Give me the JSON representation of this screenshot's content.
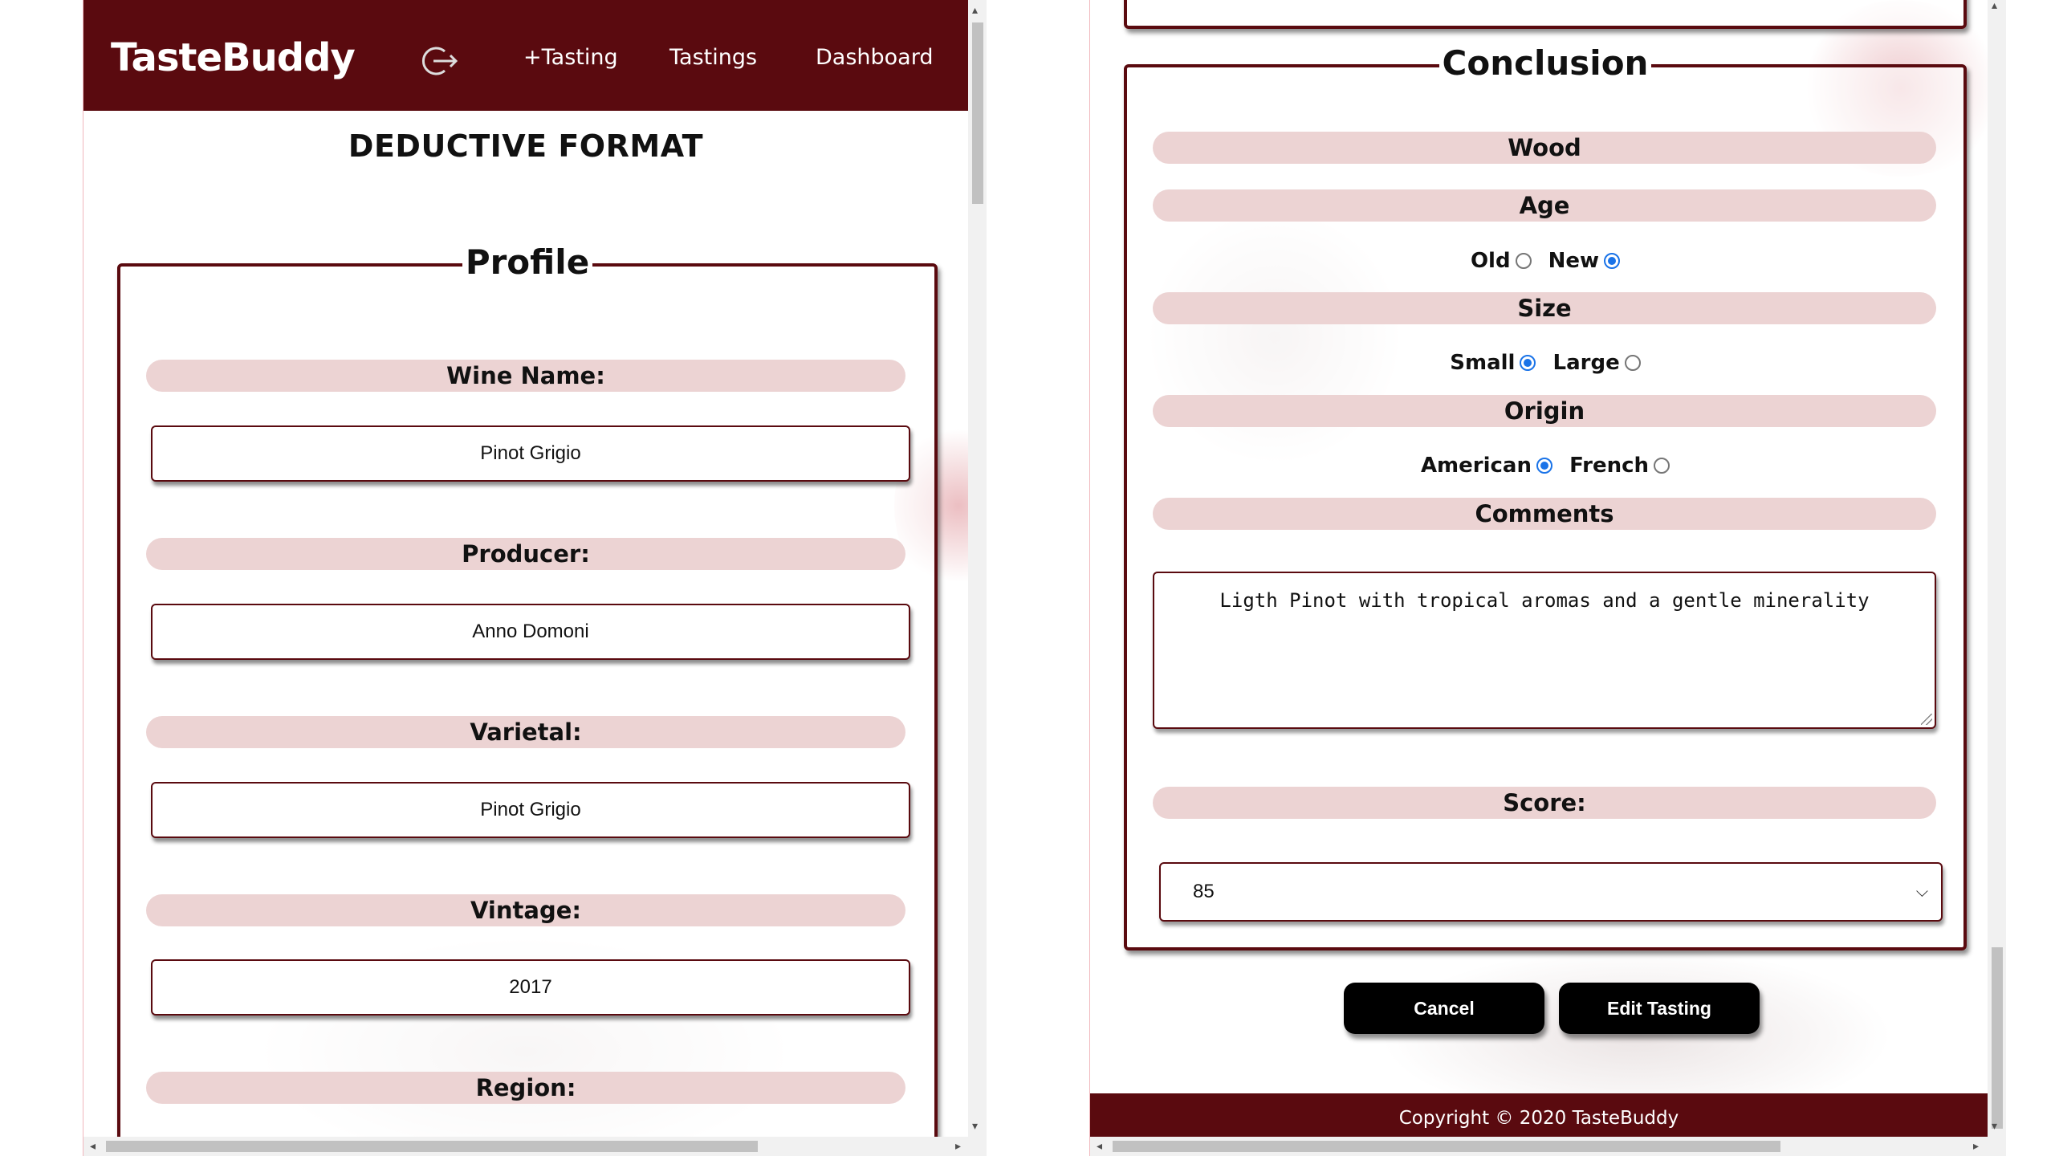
{
  "nav": {
    "brand": "TasteBuddy",
    "logout_icon": "logout-arrow-icon",
    "links": [
      "+Tasting",
      "Tastings",
      "Dashboard"
    ]
  },
  "page_heading": "DEDUCTIVE FORMAT",
  "profile": {
    "legend": "Profile",
    "fields": [
      {
        "label": "Wine Name:",
        "value": "Pinot Grigio"
      },
      {
        "label": "Producer:",
        "value": "Anno Domoni"
      },
      {
        "label": "Varietal:",
        "value": "Pinot Grigio"
      },
      {
        "label": "Vintage:",
        "value": "2017"
      },
      {
        "label": "Region:",
        "value": ""
      }
    ]
  },
  "conclusion": {
    "legend": "Conclusion",
    "wood_label": "Wood",
    "age": {
      "label": "Age",
      "options": [
        "Old",
        "New"
      ],
      "selected": "New"
    },
    "size": {
      "label": "Size",
      "options": [
        "Small",
        "Large"
      ],
      "selected": "Small"
    },
    "origin": {
      "label": "Origin",
      "options": [
        "American",
        "French"
      ],
      "selected": "American"
    },
    "comments_label": "Comments",
    "comments_value": "Ligth Pinot with tropical aromas and a gentle minerality",
    "score_label": "Score:",
    "score_value": "85"
  },
  "buttons": {
    "cancel": "Cancel",
    "edit": "Edit Tasting"
  },
  "footer": "Copyright © 2020 TasteBuddy",
  "colors": {
    "brand": "#5a0a0f",
    "label_bar": "#ecd3d3",
    "radio_checked": "#1a73e8"
  }
}
